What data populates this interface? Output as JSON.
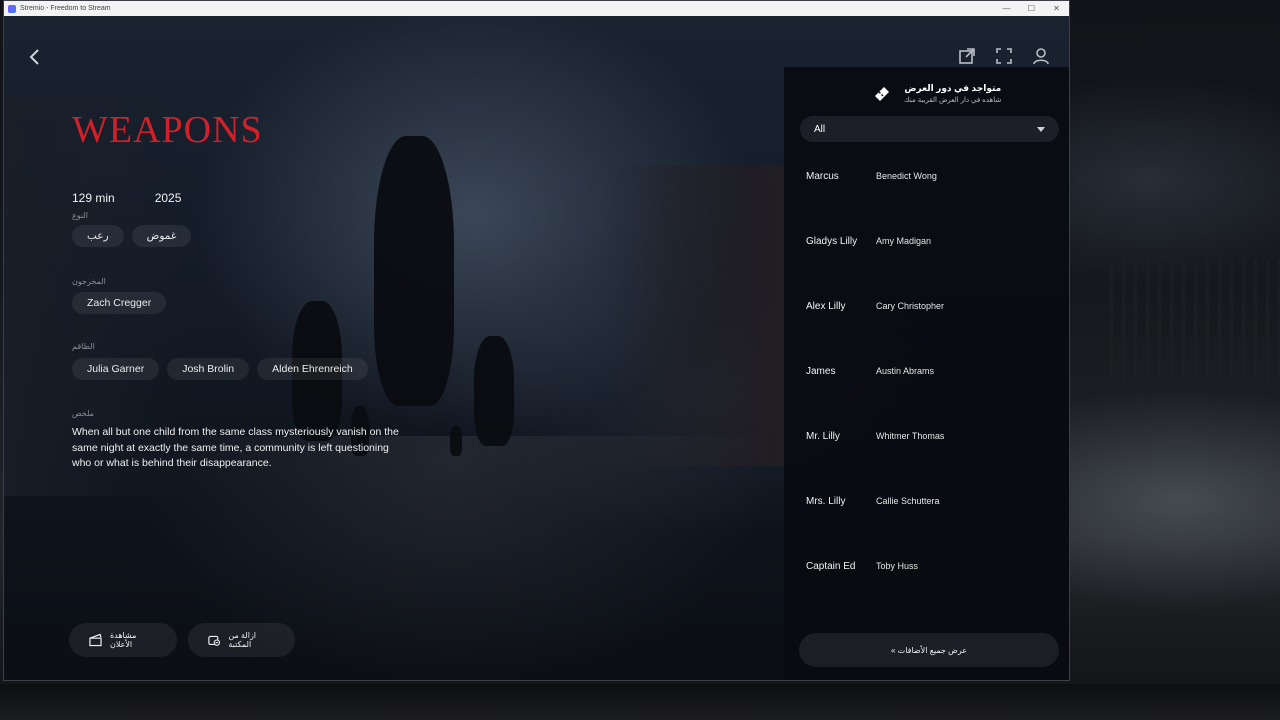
{
  "window": {
    "title": "Stremio - Freedom to Stream",
    "controls": {
      "minimize": "—",
      "maximize": "☐",
      "close": "✕"
    }
  },
  "movie": {
    "title": "WEAPONS",
    "runtime": "129 min",
    "year": "2025",
    "genre_label": "النوع",
    "genres": [
      "رعب",
      "غموض"
    ],
    "directors_label": "المخرجون",
    "directors": [
      "Zach Cregger"
    ],
    "cast_label": "الطاقم",
    "cast": [
      "Julia Garner",
      "Josh Brolin",
      "Alden Ehrenreich"
    ],
    "summary_label": "ملخص",
    "summary": "When all but one child from the same class mysteriously vanish on the same night at exactly the same time, a community is left questioning who or what is behind their disappearance."
  },
  "actions": {
    "trailer": "مشاهدة الأعلان",
    "remove_library": "ازالة من المكتبة"
  },
  "panel": {
    "theater_title": "متواجد في دور العرض",
    "theater_subtitle": "شاهده في دار العرض القريبة منك",
    "filter_value": "All",
    "cast_list": [
      {
        "character": "Marcus",
        "actor": "Benedict Wong"
      },
      {
        "character": "Gladys Lilly",
        "actor": "Amy Madigan"
      },
      {
        "character": "Alex Lilly",
        "actor": "Cary Christopher"
      },
      {
        "character": "James",
        "actor": "Austin Abrams"
      },
      {
        "character": "Mr. Lilly",
        "actor": "Whitmer Thomas"
      },
      {
        "character": "Mrs. Lilly",
        "actor": "Callie Schuttera"
      },
      {
        "character": "Captain Ed",
        "actor": "Toby Huss"
      }
    ],
    "show_all": "« عرض جميع الأضافات"
  },
  "colors": {
    "title_red": "#d1202a",
    "panel_bg": "#0a0b11"
  },
  "icons": [
    "back-arrow-icon",
    "external-link-icon",
    "fullscreen-icon",
    "user-icon",
    "ticket-icon",
    "clapperboard-icon",
    "library-remove-icon"
  ]
}
